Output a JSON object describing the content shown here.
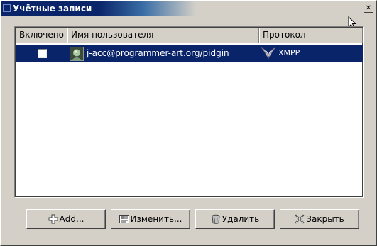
{
  "window": {
    "title": "Учётные записи",
    "close_glyph": "✕"
  },
  "columns": {
    "enabled": "Включено",
    "username": "Имя пользователя",
    "protocol": "Протокол"
  },
  "accounts": [
    {
      "enabled": false,
      "icon": "user-avatar-icon",
      "username": "j-acc@programmer-art.org/pidgin",
      "protocol_icon": "xmpp-protocol-icon",
      "protocol": "XMPP",
      "selected": true
    }
  ],
  "buttons": {
    "add": {
      "icon": "plus-icon",
      "mnemonic": "A",
      "rest": "dd..."
    },
    "modify": {
      "icon": "edit-icon",
      "mnemonic": "И",
      "rest": "зменить..."
    },
    "delete": {
      "icon": "trash-icon",
      "mnemonic": "У",
      "rest": "далить"
    },
    "close": {
      "icon": "close-x-icon",
      "mnemonic": "З",
      "rest": "акрыть"
    }
  },
  "colors": {
    "selection": "#0a246a",
    "title_active": "#0a246a",
    "face": "#d4d0c8"
  }
}
